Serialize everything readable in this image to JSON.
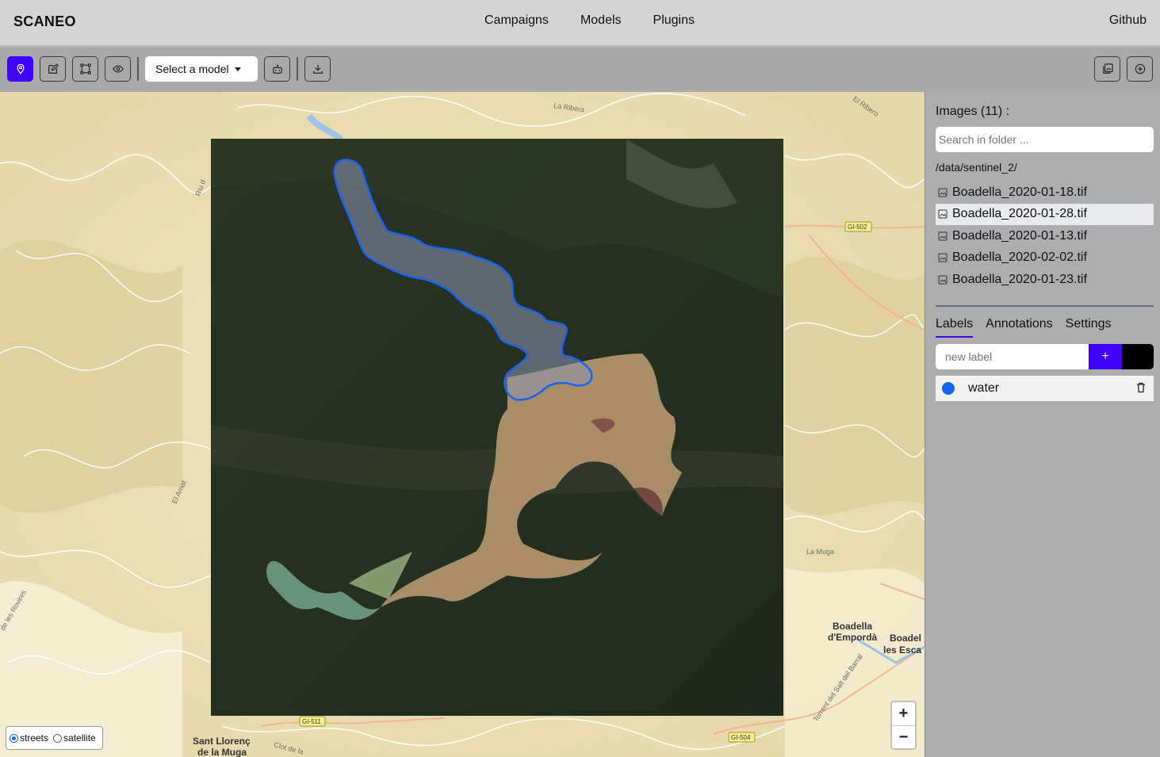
{
  "header": {
    "brand": "SCANEO",
    "nav": [
      "Campaigns",
      "Models",
      "Plugins"
    ],
    "github": "Github"
  },
  "toolbar": {
    "model_select": "Select a model"
  },
  "map": {
    "place_labels": {
      "la_ribera": "La Ribera",
      "el_ribero": "El Ribero",
      "riu": "Riu d",
      "gi502": "GI-502",
      "gi511": "GI-511",
      "gi504": "GI-504",
      "el_amat": "El Amat",
      "la_muga": "La Muga",
      "boadella1": "Boadella",
      "boadella2": "d'Empordà",
      "boadel": "Boadel",
      "les_esca": "les Esca",
      "sant_llorenc1": "Sant Llorenç",
      "sant_llorenc2": "de la Muga",
      "torrent": "Torrent del Salt del Barral",
      "rovires": "de les Rovires",
      "clot": "Clot de la"
    },
    "zoom_in": "+",
    "zoom_out": "−",
    "layers": {
      "streets": "streets",
      "satellite": "satellite",
      "selected": "streets"
    },
    "annotation_color": "#1565f5"
  },
  "sidebar": {
    "images_title": "Images (11) :",
    "search_placeholder": "Search in folder ...",
    "folder": "/data/sentinel_2/",
    "images": [
      {
        "name": "Boadella_2020-01-18.tif",
        "selected": false
      },
      {
        "name": "Boadella_2020-01-28.tif",
        "selected": true
      },
      {
        "name": "Boadella_2020-01-13.tif",
        "selected": false
      },
      {
        "name": "Boadella_2020-02-02.tif",
        "selected": false
      },
      {
        "name": "Boadella_2020-01-23.tif",
        "selected": false
      }
    ],
    "tabs": [
      "Labels",
      "Annotations",
      "Settings"
    ],
    "active_tab": "Labels",
    "new_label_placeholder": "new label",
    "add_label": "+",
    "labels": [
      {
        "name": "water",
        "color": "#1565f5"
      }
    ]
  },
  "colors": {
    "accent": "#4200ff",
    "header_bg": "#d4d4d4",
    "toolbar_bg": "#a9a9a9",
    "sidebar_bg": "#adadad"
  }
}
